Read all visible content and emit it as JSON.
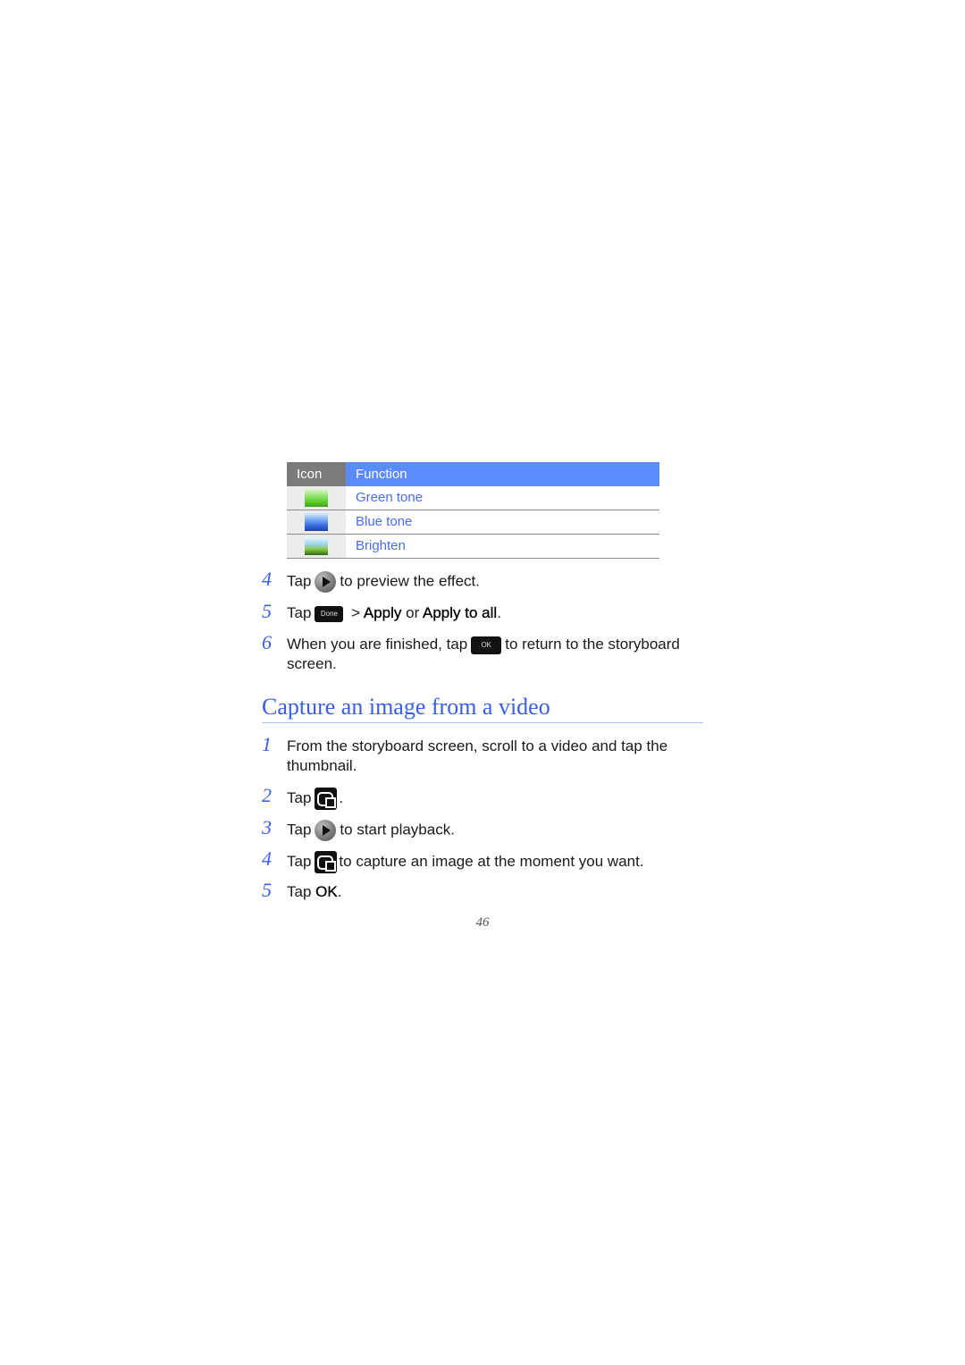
{
  "table": {
    "headers": {
      "icon": "Icon",
      "function": "Function"
    },
    "rows": [
      {
        "icon": "green-tone-thumbnail",
        "function": "Green tone"
      },
      {
        "icon": "blue-tone-thumbnail",
        "function": "Blue tone"
      },
      {
        "icon": "brighten-thumbnail",
        "function": "Brighten"
      }
    ]
  },
  "steps_a": [
    {
      "num": "4",
      "pre": "Tap",
      "icon": "play-icon",
      "post": "to preview the effect."
    },
    {
      "num": "5",
      "pre": "Tap",
      "icon": "done-button",
      "icon_label": "Done",
      "mid": " > ",
      "bold1": "Apply",
      "or": " or ",
      "bold2": "Apply to all",
      "end": "."
    },
    {
      "num": "6",
      "pre": "When you are finished, tap",
      "icon": "ok-button",
      "icon_label": "OK",
      "post": "to return to the storyboard screen."
    }
  ],
  "section": {
    "title": "Capture an image from a video"
  },
  "steps_b": [
    {
      "num": "1",
      "text": "From the storyboard screen, scroll to a video and tap the thumbnail."
    },
    {
      "num": "2",
      "pre": "Tap",
      "icon": "capture-icon",
      "post": "."
    },
    {
      "num": "3",
      "pre": "Tap",
      "icon": "play-icon",
      "post": "to start playback."
    },
    {
      "num": "4",
      "pre": "Tap",
      "icon": "capture-icon",
      "post": "to capture an image at the moment you want."
    },
    {
      "num": "5",
      "pre": "Tap",
      "bold": "OK",
      "post": "."
    }
  ],
  "page_number": "46"
}
